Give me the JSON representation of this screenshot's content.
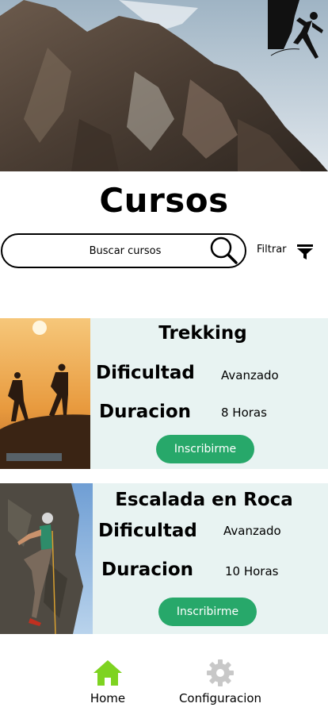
{
  "header": {
    "image": "mountain-peak-photo",
    "logo_icon": "rock-climber-icon",
    "title": "Cursos"
  },
  "search": {
    "placeholder": "Buscar cursos",
    "icon": "search-icon"
  },
  "filter": {
    "label": "Filtrar",
    "icon": "filter-funnel-icon"
  },
  "courses": [
    {
      "title": "Trekking",
      "image": "hikers-silhouette-sunset-photo",
      "difficulty_label": "Dificultad",
      "difficulty": "Avanzado",
      "duration_label": "Duracion",
      "duration": "8 Horas",
      "button": "Inscribirme"
    },
    {
      "title": "Escalada en Roca",
      "image": "rock-climber-photo",
      "difficulty_label": "Dificultad",
      "difficulty": "Avanzado",
      "duration_label": "Duracion",
      "duration": "10 Horas",
      "button": "Inscribirme"
    }
  ],
  "nav": {
    "home": {
      "label": "Home",
      "icon": "home-icon",
      "color": "#7ed321"
    },
    "settings": {
      "label": "Configuracion",
      "icon": "gear-icon",
      "color": "#c8c8c8"
    }
  },
  "colors": {
    "card_background": "#e8f3f2",
    "button": "#27a86a"
  }
}
